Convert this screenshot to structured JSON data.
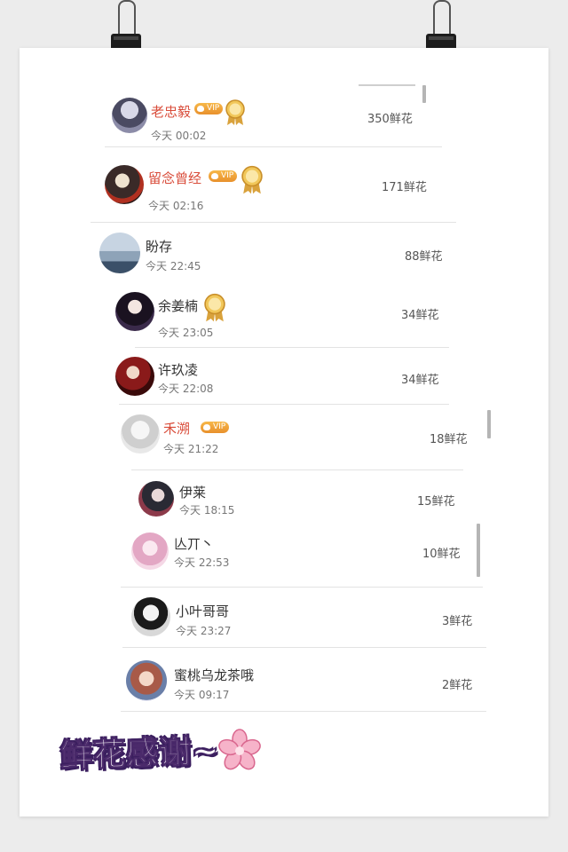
{
  "caption": "鲜花感谢~",
  "rows": [
    {
      "name": "老忠毅",
      "time": "今天 00:02",
      "flowers": "350鲜花",
      "vip": true,
      "medal": true,
      "medal_level": "lv5"
    },
    {
      "name": "留念曾经",
      "time": "今天 02:16",
      "flowers": "171鲜花",
      "vip": true,
      "medal": true,
      "medal_level": "lv1"
    },
    {
      "name": "盼存",
      "time": "今天 22:45",
      "flowers": "88鲜花",
      "vip": false,
      "medal": false
    },
    {
      "name": "余姜楠",
      "time": "今天 23:05",
      "flowers": "34鲜花",
      "vip": false,
      "medal": true,
      "medal_level": "lv1"
    },
    {
      "name": "许玖凌",
      "time": "今天 22:08",
      "flowers": "34鲜花",
      "vip": false,
      "medal": false
    },
    {
      "name": "禾溯",
      "time": "今天 21:22",
      "flowers": "18鲜花",
      "vip": true,
      "medal": false
    },
    {
      "name": "伊莱",
      "time": "今天 18:15",
      "flowers": "15鲜花",
      "vip": false,
      "medal": false
    },
    {
      "name": "亾丌丶",
      "time": "今天 22:53",
      "flowers": "10鲜花",
      "vip": false,
      "medal": false
    },
    {
      "name": "小叶哥哥",
      "time": "今天 23:27",
      "flowers": "3鲜花",
      "vip": false,
      "medal": false
    },
    {
      "name": "蜜桃乌龙茶哦",
      "time": "今天 09:17",
      "flowers": "2鲜花",
      "vip": false,
      "medal": false
    }
  ],
  "vip_label": "VIP",
  "colors": {
    "vip_name": "#d94c3a",
    "vip_badge": "#f0a23a",
    "caption_stroke": "#3b1f5f",
    "medal": "#e6b34a"
  }
}
